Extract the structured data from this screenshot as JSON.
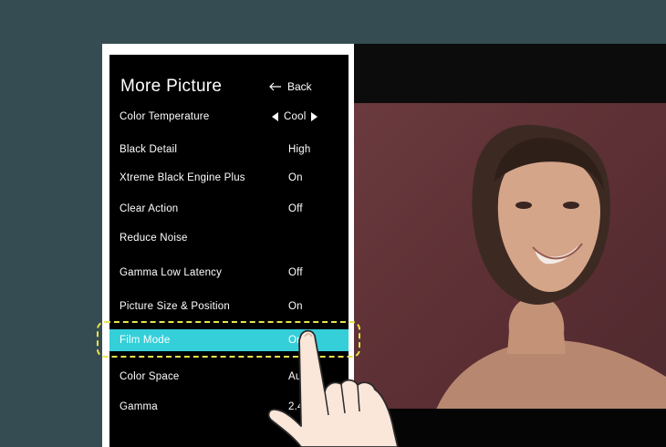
{
  "menu": {
    "title": "More Picture",
    "back_label": "Back",
    "items": [
      {
        "label": "Color Temperature",
        "value": "Cool"
      },
      {
        "label": "Black Detail",
        "value": "High"
      },
      {
        "label": "Xtreme Black Engine Plus",
        "value": "On"
      },
      {
        "label": "Clear Action",
        "value": "Off"
      },
      {
        "label": "Reduce Noise",
        "value": ""
      },
      {
        "label": "Gamma Low Latency",
        "value": "Off"
      },
      {
        "label": "Picture Size & Position",
        "value": "On"
      },
      {
        "label": "Film Mode",
        "value": "On"
      },
      {
        "label": "Color Space",
        "value": "Auto"
      },
      {
        "label": "Gamma",
        "value": "2.4"
      }
    ]
  },
  "colors": {
    "background": "#354c52",
    "panel": "#000000",
    "selection": "#35cfd9",
    "highlight": "#e9e34a"
  }
}
